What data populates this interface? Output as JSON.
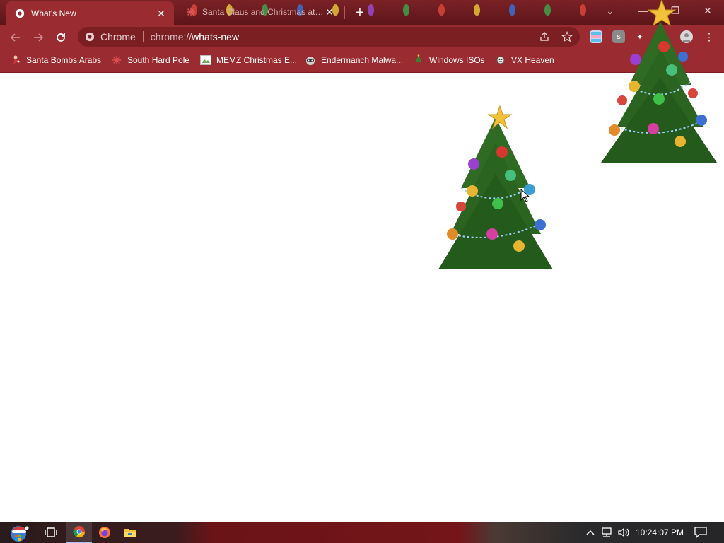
{
  "tabs": [
    {
      "title": "What's New",
      "active": true
    },
    {
      "title": "Santa Claus and Christmas at the",
      "active": false
    }
  ],
  "omnibox": {
    "chip_label": "Chrome",
    "url_prefix": "chrome://",
    "url_path": "whats-new"
  },
  "bookmarks": [
    {
      "label": "Santa Bombs Arabs",
      "icon": "santa-icon"
    },
    {
      "label": "South Hard Pole",
      "icon": "snowflake-icon"
    },
    {
      "label": "MEMZ Christmas E...",
      "icon": "image-icon"
    },
    {
      "label": "Endermanch Malwa...",
      "icon": "raccoon-icon"
    },
    {
      "label": "Windows ISOs",
      "icon": "tree-icon"
    },
    {
      "label": "VX Heaven",
      "icon": "virus-icon"
    }
  ],
  "taskbar": {
    "clock": "10:24:07 PM"
  },
  "colors": {
    "tabstrip": "#6e1b1f",
    "toolbar": "#9a2b30",
    "omnibox": "#7c1f23"
  }
}
